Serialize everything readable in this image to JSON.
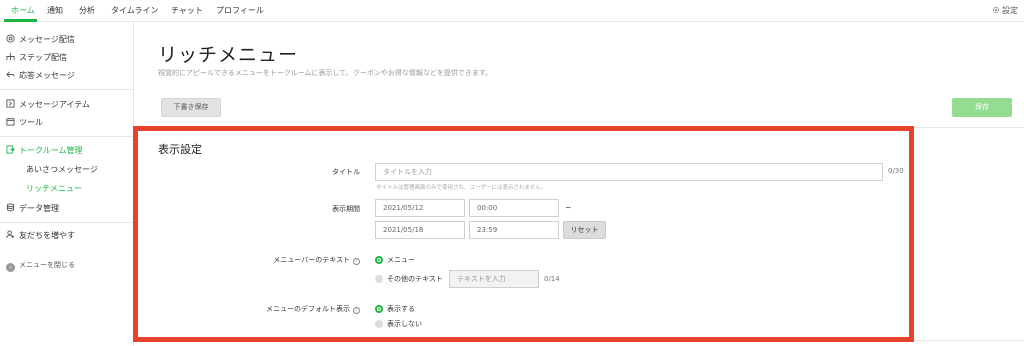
{
  "topnav": {
    "tabs": [
      "ホーム",
      "通知",
      "分析",
      "タイムライン",
      "チャット",
      "プロフィール"
    ],
    "settings": "設定"
  },
  "sidebar": {
    "items": [
      {
        "label": "メッセージ配信",
        "icon": "broadcast-icon"
      },
      {
        "label": "ステップ配信",
        "icon": "step-icon"
      },
      {
        "label": "応答メッセージ",
        "icon": "reply-icon"
      },
      {
        "label": "メッセージアイテム",
        "icon": "message-item-icon"
      },
      {
        "label": "ツール",
        "icon": "tool-icon"
      },
      {
        "label": "トークルーム管理",
        "icon": "talkroom-icon"
      },
      {
        "label": "データ管理",
        "icon": "database-icon"
      },
      {
        "label": "友だちを増やす",
        "icon": "add-friend-icon"
      }
    ],
    "subitems": [
      "あいさつメッセージ",
      "リッチメニュー"
    ],
    "close_label": "メニューを閉じる"
  },
  "main": {
    "title": "リッチメニュー",
    "description": "視覚的にアピールできるメニューをトークルームに表示して、クーポンやお得な情報などを提供できます。",
    "draft_button": "下書き保存",
    "save_button": "保存"
  },
  "settings_section": {
    "title": "表示設定",
    "title_field": {
      "label": "タイトル",
      "placeholder": "タイトルを入力",
      "counter": "0/30",
      "hint": "タイトルは管理画面のみで使用され、ユーザーには表示されません。"
    },
    "period": {
      "label": "表示期間",
      "start_date": "2021/05/12",
      "start_time": "00:00",
      "separator": "~",
      "end_date": "2021/05/18",
      "end_time": "23:59",
      "reset_button": "リセット"
    },
    "menubar_text": {
      "label": "メニューバーのテキスト",
      "option_menu": "メニュー",
      "option_other": "その他のテキスト",
      "other_placeholder": "テキストを入力",
      "counter": "0/14"
    },
    "default_display": {
      "label": "メニューのデフォルト表示",
      "option_show": "表示する",
      "option_hide": "表示しない"
    }
  },
  "colors": {
    "accent": "#1db446",
    "highlight_frame": "#e8412c",
    "save_button_bg": "#93dc90"
  }
}
